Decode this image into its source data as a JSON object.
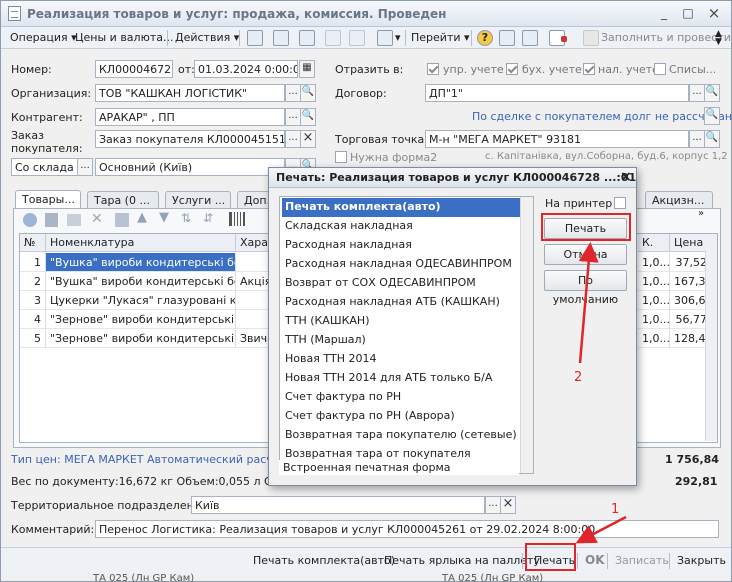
{
  "window": {
    "title": "Реализация товаров и услуг: продажа, комиссия. Проведен",
    "controls": [
      "_",
      "□",
      "×"
    ]
  },
  "toolbar": {
    "operation": "Операция",
    "prices": "Цены и валюта...",
    "actions": "Действия",
    "goto": "Перейти",
    "fill_post": "Заполнить и провести",
    "help": "?"
  },
  "header": {
    "number_label": "Номер:",
    "number": "КЛ000046728",
    "from_label": "от:",
    "date": "01.03.2024  0:00:01",
    "org_label": "Организация:",
    "org": "ТОВ \"КАШКАН ЛОГІСТИК\"",
    "counterparty_label": "Контрагент:",
    "counterparty": "АРАКАР\" , ПП",
    "order_label": "Заказ покупателя:",
    "order": "Заказ покупателя КЛ000045151 о",
    "warehouse_type": "Со склада",
    "warehouse": "Основний (Київ)",
    "reflect_label": "Отразить в:",
    "reflect": [
      "упр. учете",
      "бух. учете",
      "нал. учете",
      "Списы..."
    ],
    "contract_label": "Договор:",
    "contract": "ДП\"1\"",
    "debt_link": "По сделке с покупателем долг не рассчитан",
    "point_label": "Торговая точка:",
    "point": "М-н \"МЕГА МАРКЕТ\" 93181",
    "form2": "Нужна форма2",
    "address": "с. Капітанівка, вул.Соборна, буд.6, корпус 1,2"
  },
  "tabs": [
    "Товары...",
    "Тара (0 ...",
    "Услуги ...",
    "Доп...",
    "Акцизн..."
  ],
  "table": {
    "headers": [
      "№",
      "Номенклатура",
      "Харак",
      "К.",
      "Цена"
    ],
    "rows": [
      {
        "n": "1",
        "name": "\"Вушка\" вироби кондитерські бо...",
        "char": "",
        "k": "1,0...",
        "price": "37,520"
      },
      {
        "n": "2",
        "name": "\"Вушка\" вироби кондитерські бо...",
        "char": "Акція",
        "k": "1,0...",
        "price": "167,380"
      },
      {
        "n": "3",
        "name": "Цукерки \"Лукася\" глазуровані к...",
        "char": "",
        "k": "1,0...",
        "price": "306,650"
      },
      {
        "n": "4",
        "name": "\"Зернове\" вироби кондитерські ...",
        "char": "",
        "k": "1,0...",
        "price": "56,770"
      },
      {
        "n": "5",
        "name": "\"Зернове\" вироби кондитерські бо...",
        "char": "Звича",
        "k": "1,0...",
        "price": "128,440"
      }
    ]
  },
  "footer": {
    "price_type": "Тип цен: МЕГА МАРКЕТ Автоматический расчет Н",
    "total": "1 756,84",
    "weight": "Вес по документу:16,672 кг Объем:0,055 л Объем",
    "vat": "292,81",
    "territorial_label": "Территориальное подразделение:",
    "territorial": "Київ",
    "comment_label": "Комментарий:",
    "comment": "Перенос Логистика: Реализация товаров и услуг КЛ000045261 от 29.02.2024 8:00:00"
  },
  "bottom": {
    "print_set": "Печать комплекта(авто)",
    "print_label": "Печать ярлыка на паллету",
    "print": "Печать",
    "ok": "OK",
    "save": "Записать",
    "close": "Закрыть",
    "below": "ТА 025 (Лн GP Кам)"
  },
  "dialog": {
    "title": "Печать: Реализация товаров и услуг КЛ000046728 ...:01",
    "items": [
      "Печать комплекта(авто)",
      "Складская накладная",
      "Расходная накладная",
      "Расходная накладная ОДЕСАВИНПРОМ",
      "Возврат от СОХ ОДЕСАВИНПРОМ",
      "Расходная накладная АТБ (КАШКАН)",
      "ТТН (КАШКАН)",
      "ТТН (Маршал)",
      "Новая ТТН 2014",
      "Новая ТТН 2014 для АТБ только Б/А",
      "Счет фактура по РН",
      "Счет фактура по РН (Аврора)",
      "Возвратная тара покупателю (сетевые)",
      "Возвратная тара от покупателя"
    ],
    "builtin": "Встроенная печатная форма",
    "to_printer": "На принтер",
    "print": "Печать",
    "cancel": "Отмена",
    "default": "По умолчанию"
  },
  "annotations": {
    "one": "1",
    "two": "2",
    "color": "#e0262b"
  }
}
